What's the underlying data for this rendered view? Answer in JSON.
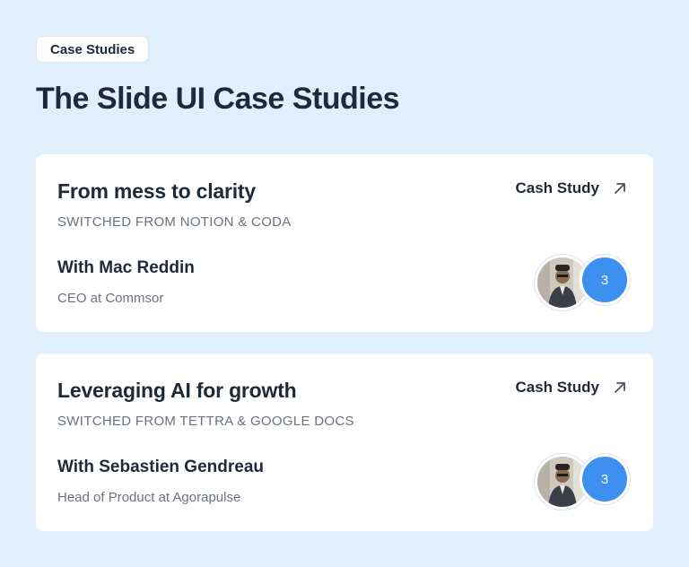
{
  "header": {
    "badge": "Case Studies",
    "title": "The Slide UI Case Studies"
  },
  "cards": [
    {
      "title": "From mess to clarity",
      "subtitle": "SWITCHED FROM NOTION & CODA",
      "cta_label": "Cash Study",
      "cta_icon": "arrow-up-right-icon",
      "person_name": "With Mac Reddin",
      "person_role": "CEO at Commsor",
      "avatar_count": "3"
    },
    {
      "title": "Leveraging AI for growth",
      "subtitle": "SWITCHED FROM TETTRA & GOOGLE DOCS",
      "cta_label": "Cash Study",
      "cta_icon": "arrow-up-right-icon",
      "person_name": "With Sebastien Gendreau",
      "person_role": "Head of Product at Agorapulse",
      "avatar_count": "3"
    }
  ],
  "colors": {
    "background": "#e1effd",
    "card": "#ffffff",
    "text": "#1f2937",
    "muted": "#6b7280",
    "accent": "#3d8ff0"
  }
}
